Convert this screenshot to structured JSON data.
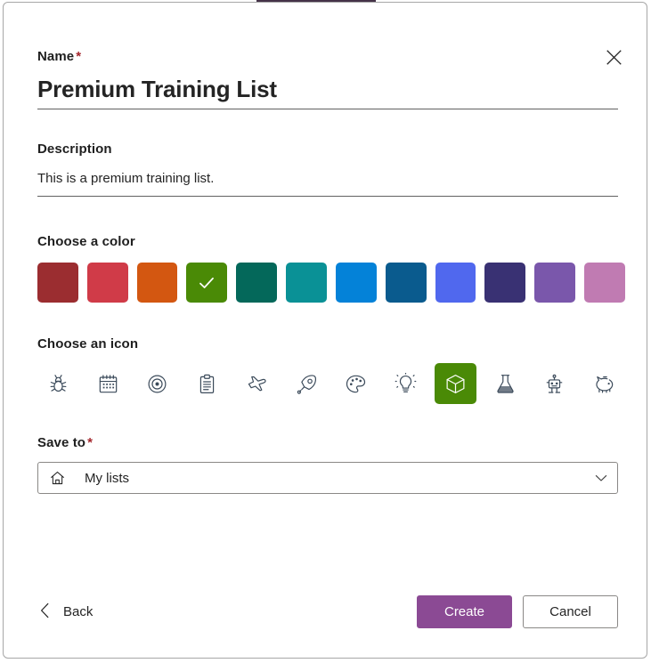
{
  "dialog": {
    "close_icon": "close-icon"
  },
  "name_field": {
    "label": "Name",
    "required_marker": "*",
    "value": "Premium Training List"
  },
  "description_field": {
    "label": "Description",
    "value": "This is a premium training list."
  },
  "color_picker": {
    "label": "Choose a color",
    "selected_index": 3,
    "swatches": [
      {
        "name": "dark-red",
        "hex": "#9B2D30"
      },
      {
        "name": "red",
        "hex": "#D03B48"
      },
      {
        "name": "orange",
        "hex": "#D35711"
      },
      {
        "name": "green",
        "hex": "#4A8A06"
      },
      {
        "name": "dark-teal",
        "hex": "#04685A"
      },
      {
        "name": "teal",
        "hex": "#0A9196"
      },
      {
        "name": "blue",
        "hex": "#0482D8"
      },
      {
        "name": "dark-blue",
        "hex": "#0A5B8E"
      },
      {
        "name": "periwinkle",
        "hex": "#5068EE"
      },
      {
        "name": "dark-purple",
        "hex": "#393173"
      },
      {
        "name": "purple",
        "hex": "#7A57AB"
      },
      {
        "name": "pink",
        "hex": "#C07BB2"
      }
    ]
  },
  "icon_picker": {
    "label": "Choose an icon",
    "selected_index": 8,
    "selected_bg_hex": "#4A8A06",
    "icons": [
      {
        "name": "bug-icon"
      },
      {
        "name": "calendar-icon"
      },
      {
        "name": "target-icon"
      },
      {
        "name": "clipboard-icon"
      },
      {
        "name": "airplane-icon"
      },
      {
        "name": "rocket-icon"
      },
      {
        "name": "palette-icon"
      },
      {
        "name": "lightbulb-icon"
      },
      {
        "name": "box-icon"
      },
      {
        "name": "beaker-icon"
      },
      {
        "name": "robot-icon"
      },
      {
        "name": "piggy-bank-icon"
      }
    ]
  },
  "save_to": {
    "label": "Save to",
    "required_marker": "*",
    "selected": "My lists",
    "home_icon": "home-icon",
    "chevron_icon": "chevron-down-icon"
  },
  "footer": {
    "back_label": "Back",
    "back_icon": "chevron-left-icon",
    "create_label": "Create",
    "cancel_label": "Cancel",
    "create_color_hex": "#8B4A94"
  }
}
